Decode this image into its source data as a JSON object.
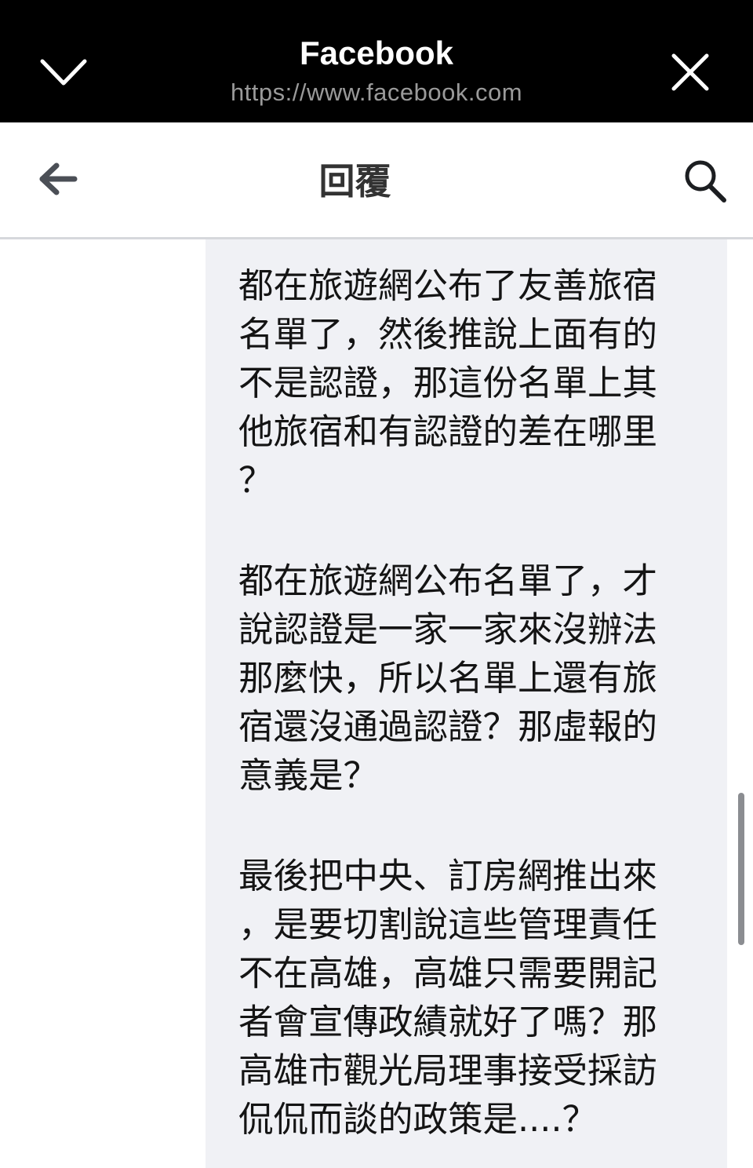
{
  "browser": {
    "title": "Facebook",
    "url": "https://www.facebook.com",
    "dismiss_icon": "chevron-down-icon",
    "close_icon": "close-icon"
  },
  "nav": {
    "heading": "回覆",
    "back_icon": "back-arrow-icon",
    "search_icon": "search-icon"
  },
  "comment": {
    "paragraphs": [
      "都在旅遊網公布了友善旅宿\n名單了，然後推說上面有的\n不是認證，那這份名單上其\n他旅宿和有認證的差在哪里\n？",
      "都在旅遊網公布名單了，才\n說認證是一家一家來沒辦法\n那麼快，所以名單上還有旅\n宿還沒通過認證？那虛報的\n意義是？",
      "最後把中央、訂房網推出來\n，是要切割說這些管理責任\n不在高雄，高雄只需要開記\n者會宣傳政績就好了嗎？那\n高雄市觀光局理事接受採訪\n侃侃而談的政策是....？"
    ]
  },
  "colors": {
    "topbar_bg": "#000000",
    "bubble_bg": "#f0f1f5",
    "text": "#141414",
    "url_text": "#9a9a9a"
  }
}
